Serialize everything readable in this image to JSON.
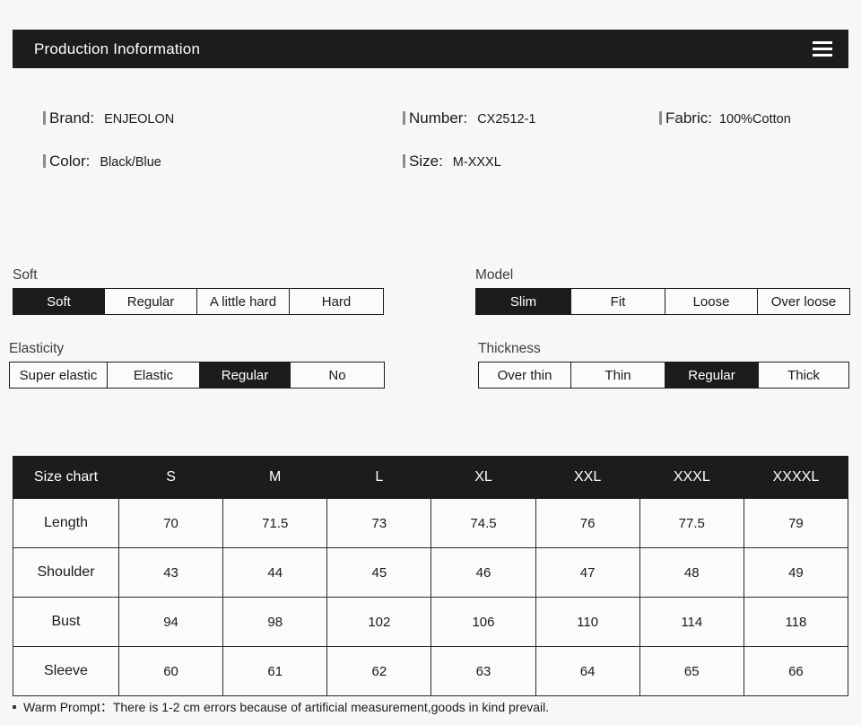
{
  "header": {
    "title": "Production Inoformation",
    "menu_icon": "hamburger-icon"
  },
  "info": {
    "brand": {
      "label": "Brand:",
      "value": "ENJEOLON"
    },
    "color": {
      "label": "Color:",
      "value": "Black/Blue"
    },
    "number": {
      "label": "Number:",
      "value": "CX2512-1"
    },
    "size": {
      "label": "Size:",
      "value": "M-XXXL"
    },
    "fabric": {
      "label": "Fabric:",
      "value": "100%Cotton"
    }
  },
  "attributes": [
    {
      "key": "soft",
      "title": "Soft",
      "options": [
        "Soft",
        "Regular",
        "A little hard",
        "Hard"
      ],
      "selected": "Soft"
    },
    {
      "key": "model",
      "title": "Model",
      "options": [
        "Slim",
        "Fit",
        "Loose",
        "Over loose"
      ],
      "selected": "Slim"
    },
    {
      "key": "elasticity",
      "title": "Elasticity",
      "options": [
        "Super elastic",
        "Elastic",
        "Regular",
        "No"
      ],
      "selected": "Regular"
    },
    {
      "key": "thickness",
      "title": "Thickness",
      "options": [
        "Over thin",
        "Thin",
        "Regular",
        "Thick"
      ],
      "selected": "Regular"
    }
  ],
  "size_chart": {
    "columns": [
      "Size chart",
      "S",
      "M",
      "L",
      "XL",
      "XXL",
      "XXXL",
      "XXXXL"
    ],
    "rows": [
      {
        "label": "Length",
        "values": [
          "70",
          "71.5",
          "73",
          "74.5",
          "76",
          "77.5",
          "79"
        ]
      },
      {
        "label": "Shoulder",
        "values": [
          "43",
          "44",
          "45",
          "46",
          "47",
          "48",
          "49"
        ]
      },
      {
        "label": "Bust",
        "values": [
          "94",
          "98",
          "102",
          "106",
          "110",
          "114",
          "118"
        ]
      },
      {
        "label": "Sleeve",
        "values": [
          "60",
          "61",
          "62",
          "63",
          "64",
          "65",
          "66"
        ]
      }
    ]
  },
  "footer": {
    "note": "Warm Prompt：There is 1-2 cm errors because of artificial measurement,goods in kind prevail."
  },
  "colors": {
    "header_bg": "#1c1c1c",
    "page_bg": "#f7f7f7",
    "cell_bg": "#fbfbfb",
    "selected_bg": "#1c1c1c",
    "text": "#1a1a1a"
  }
}
